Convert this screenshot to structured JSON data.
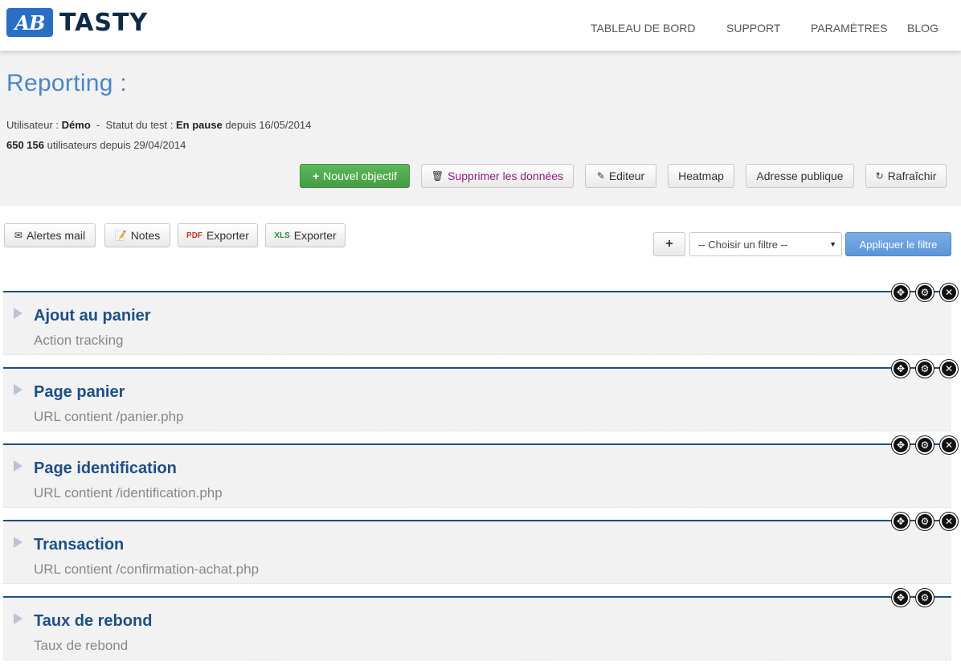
{
  "header": {
    "logo_mark": "AB",
    "logo_text": "TASTY",
    "nav": [
      "TABLEAU DE BORD",
      "SUPPORT",
      "PARAMÈTRES",
      "BLOG"
    ]
  },
  "report": {
    "title": "Reporting :",
    "user_label": "Utilisateur : ",
    "user_value": "Démo",
    "status_sep": "  -  Statut du test : ",
    "status_value": "En pause",
    "status_since": " depuis 16/05/2014",
    "users_count": "650 156",
    "users_since": " utilisateurs depuis 29/04/2014"
  },
  "actions": {
    "new_goal": "Nouvel objectif",
    "delete_data": "Supprimer les données",
    "editor": "Editeur",
    "heatmap": "Heatmap",
    "public_address": "Adresse publique",
    "refresh": "Rafraîchir"
  },
  "toolbar": {
    "mail_alerts": "Alertes mail",
    "notes": "Notes",
    "export_pdf": "Exporter",
    "export_xls": "Exporter",
    "add": "+",
    "filter_selected": "-- Choisir un filtre --",
    "apply_filter": "Appliquer le filtre"
  },
  "goals": [
    {
      "name": "Ajout au panier",
      "desc": "Action tracking"
    },
    {
      "name": "Page panier",
      "desc": "URL contient /panier.php"
    },
    {
      "name": "Page identification",
      "desc": "URL contient /identification.php"
    },
    {
      "name": "Transaction",
      "desc": "URL contient /confirmation-achat.php"
    },
    {
      "name": "Taux de rebond",
      "desc": "Taux de rebond"
    }
  ]
}
